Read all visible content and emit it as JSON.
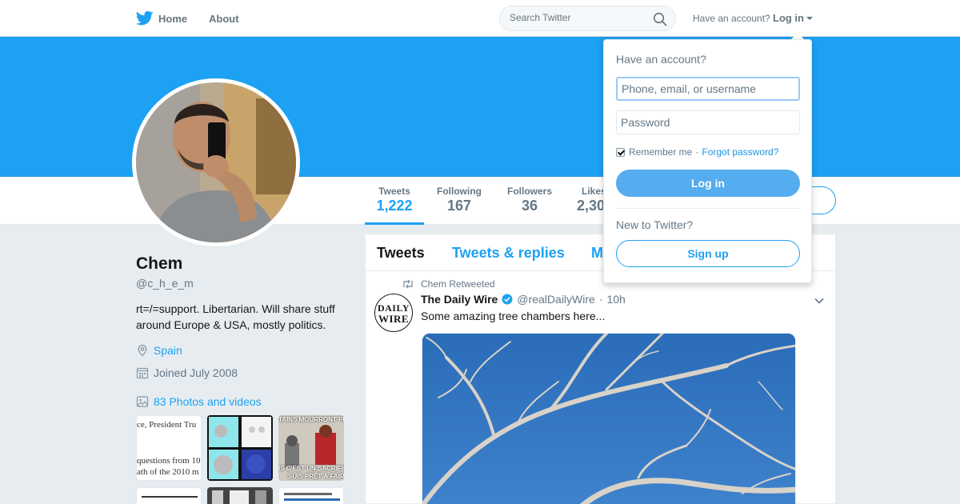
{
  "nav": {
    "home_label": "Home",
    "about_label": "About",
    "search_placeholder": "Search Twitter",
    "have_account": "Have an account?",
    "login_label": "Log in"
  },
  "profile": {
    "name": "Chem",
    "handle": "@c_h_e_m",
    "bio_line1": "rt=/=support. Libertarian. Will share stuff",
    "bio_line2": "around Europe & USA, mostly politics.",
    "location": "Spain",
    "joined": "Joined July 2008",
    "photos_label": "83 Photos and videos"
  },
  "stats": [
    {
      "label": "Tweets",
      "value": "1,222"
    },
    {
      "label": "Following",
      "value": "167"
    },
    {
      "label": "Followers",
      "value": "36"
    },
    {
      "label": "Likes",
      "value": "2,30"
    }
  ],
  "thumbnails": {
    "t1_line1": "ce, President Tru",
    "t1_line2": "questions from 10",
    "t1_line3": "ath of the 2010 m",
    "t3_top": "TAINS MOURRONT PEUT-",
    "t3_bottom1": "IS C'EST UN SACRIFICE QU",
    "t3_bottom2": "SUIS PRÊT À FAIRE"
  },
  "timeline": {
    "tabs": [
      "Tweets",
      "Tweets & replies",
      "M"
    ],
    "tweet": {
      "retweet_label": "Chem Retweeted",
      "avatar_line1": "DAILY",
      "avatar_line2": "WIRE",
      "author_name": "The Daily Wire",
      "author_handle": "@realDailyWire",
      "dot": "·",
      "time": "10h",
      "text": "Some amazing tree chambers here..."
    }
  },
  "login_dropdown": {
    "title": "Have an account?",
    "username_placeholder": "Phone, email, or username",
    "password_placeholder": "Password",
    "remember_label": "Remember me",
    "separator": "·",
    "forgot_label": "Forgot password?",
    "login_button": "Log in",
    "new_label": "New to Twitter?",
    "signup_button": "Sign up"
  },
  "colors": {
    "brand_blue": "#1da1f2",
    "login_button": "#55acee",
    "background": "#e6ecf0"
  }
}
